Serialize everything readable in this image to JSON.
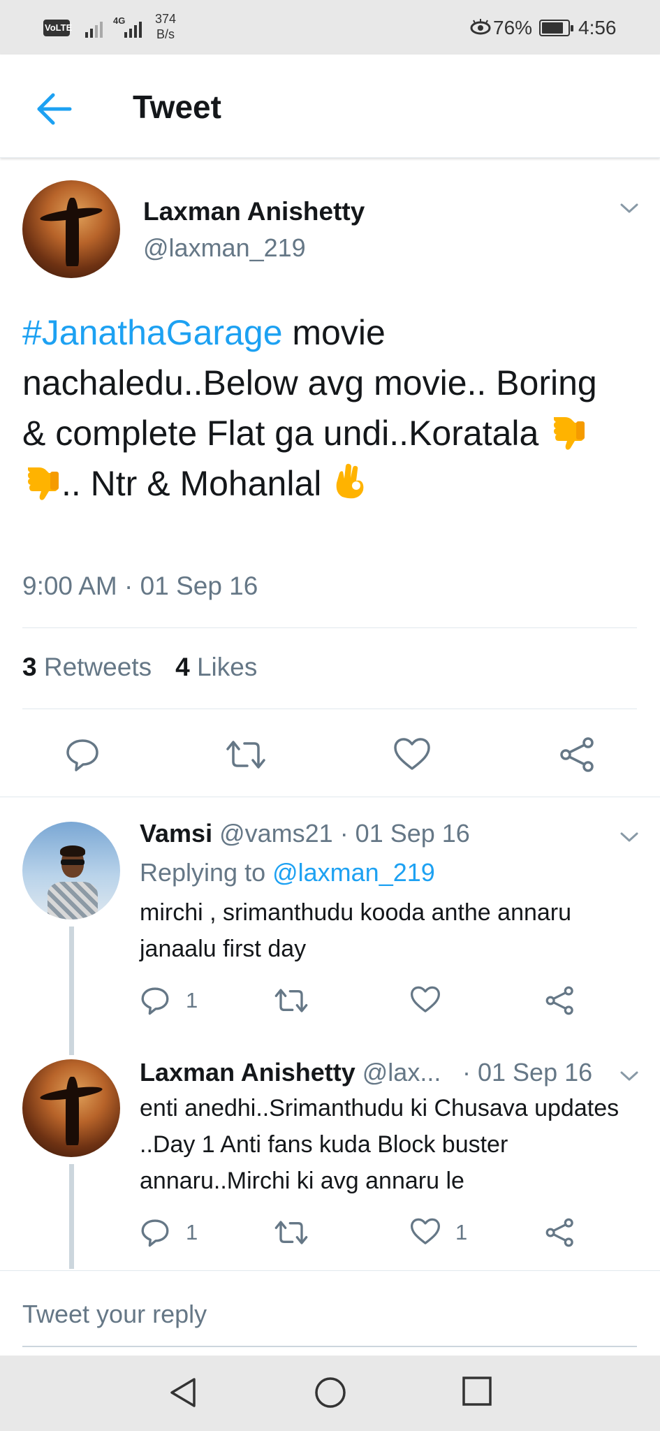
{
  "status_bar": {
    "volte": "VoLTE",
    "network": "4G",
    "speed_value": "374",
    "speed_unit": "B/s",
    "battery": "76%",
    "time": "4:56"
  },
  "header": {
    "title": "Tweet"
  },
  "tweet": {
    "author_name": "Laxman Anishetty",
    "author_handle": "@laxman_219",
    "hashtag": "#JanathaGarage",
    "text_part1": " movie nachaledu..Below avg movie.. Boring & complete Flat ga undi..Koratala ",
    "text_part2": "..  Ntr & Mohanlal ",
    "timestamp": "9:00 AM · 01 Sep 16",
    "retweets_count": "3",
    "retweets_label": "Retweets",
    "likes_count": "4",
    "likes_label": "Likes"
  },
  "replies": [
    {
      "name": "Vamsi",
      "meta": " @vams21 · 01 Sep 16",
      "replying_label": "Replying to ",
      "replying_to": "@laxman_219",
      "text": "mirchi ,  srimanthudu kooda anthe annaru janaalu first day",
      "reply_count": "1",
      "like_count": ""
    },
    {
      "name": "Laxman Anishetty",
      "meta": " @lax...",
      "date": "· 01 Sep 16",
      "text": "enti anedhi..Srimanthudu ki Chusava updates ..Day 1 Anti fans kuda Block buster annaru..Mirchi ki avg annaru le",
      "reply_count": "1",
      "like_count": "1"
    }
  ],
  "composer": {
    "placeholder": "Tweet your reply"
  },
  "colors": {
    "accent": "#1da1f2",
    "text": "#14171a",
    "muted": "#657786",
    "icon": "#657786"
  },
  "icons": {
    "back": "arrow-left-icon",
    "reply": "comment-icon",
    "retweet": "retweet-icon",
    "like": "heart-icon",
    "share": "share-icon",
    "caret": "chevron-down-icon",
    "thumbs_down": "thumbs-down-emoji",
    "ok_hand": "ok-hand-emoji"
  }
}
